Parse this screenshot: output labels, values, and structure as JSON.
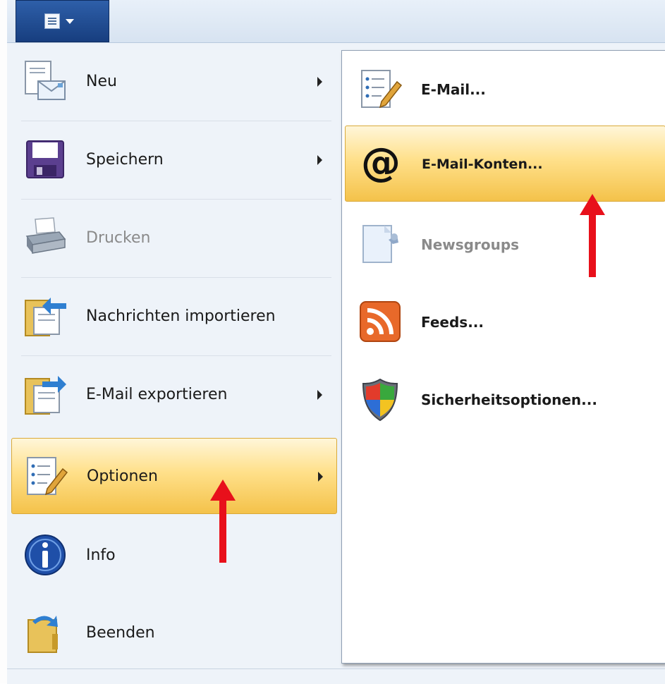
{
  "menu": {
    "left_items": [
      {
        "label": "Neu",
        "icon": "new-document-mail-icon",
        "has_submenu": true,
        "disabled": false,
        "highlighted": false
      },
      {
        "label": "Speichern",
        "icon": "floppy-disk-icon",
        "has_submenu": true,
        "disabled": false,
        "highlighted": false
      },
      {
        "label": "Drucken",
        "icon": "printer-icon",
        "has_submenu": false,
        "disabled": true,
        "highlighted": false
      },
      {
        "label": "Nachrichten importieren",
        "icon": "folder-import-icon",
        "has_submenu": false,
        "disabled": false,
        "highlighted": false
      },
      {
        "label": "E-Mail exportieren",
        "icon": "folder-export-icon",
        "has_submenu": true,
        "disabled": false,
        "highlighted": false
      },
      {
        "label": "Optionen",
        "icon": "options-checklist-icon",
        "has_submenu": true,
        "disabled": false,
        "highlighted": true
      },
      {
        "label": "Info",
        "icon": "info-icon",
        "has_submenu": false,
        "disabled": false,
        "highlighted": false
      },
      {
        "label": "Beenden",
        "icon": "exit-folder-icon",
        "has_submenu": false,
        "disabled": false,
        "highlighted": false
      }
    ],
    "right_items": [
      {
        "label": "E-Mail...",
        "icon": "mail-options-icon",
        "disabled": false,
        "highlighted": false
      },
      {
        "label": "E-Mail-Konten...",
        "icon": "at-sign-icon",
        "disabled": false,
        "highlighted": true
      },
      {
        "label": "Newsgroups",
        "icon": "newsgroups-icon",
        "disabled": true,
        "highlighted": false
      },
      {
        "label": "Feeds...",
        "icon": "rss-feed-icon",
        "disabled": false,
        "highlighted": false
      },
      {
        "label": "Sicherheitsoptionen...",
        "icon": "security-shield-icon",
        "disabled": false,
        "highlighted": false
      }
    ]
  },
  "colors": {
    "app_button": "#1f4a91",
    "highlight": "#f4c24a",
    "annotation_arrow": "#e8101b"
  }
}
